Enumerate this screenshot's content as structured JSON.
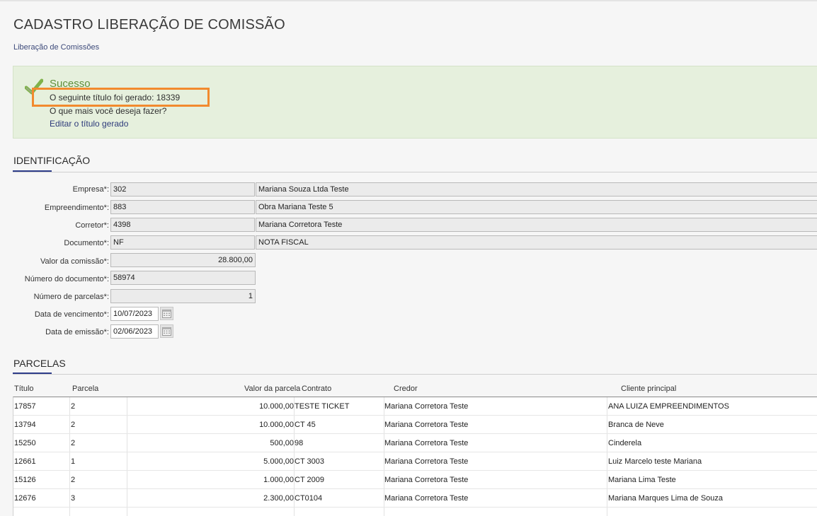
{
  "page": {
    "title": "CADASTRO LIBERAÇÃO DE COMISSÃO",
    "breadcrumb": "Liberação de Comissões"
  },
  "alert": {
    "title": "Sucesso",
    "message": "O seguinte título foi gerado: 18339",
    "question": "O que mais você deseja fazer?",
    "link": "Editar o título gerado",
    "highlight_color": "#f28a2e",
    "background_color": "#e6f0dd"
  },
  "identificacao": {
    "title": "IDENTIFICAÇÃO",
    "accent_color": "#2e3d8a",
    "fields": {
      "empresa": {
        "label": "Empresa*:",
        "code": "302",
        "desc": "Mariana Souza Ltda Teste"
      },
      "empreendimento": {
        "label": "Empreendimento*:",
        "code": "883",
        "desc": "Obra Mariana Teste 5"
      },
      "corretor": {
        "label": "Corretor*:",
        "code": "4398",
        "desc": "Mariana Corretora Teste"
      },
      "documento": {
        "label": "Documento*:",
        "code": "NF",
        "desc": "NOTA FISCAL"
      },
      "valor_comissao": {
        "label": "Valor da comissão*:",
        "value": "28.800,00"
      },
      "numero_documento": {
        "label": "Número do documento*:",
        "value": "58974"
      },
      "numero_parcelas": {
        "label": "Número de parcelas*:",
        "value": "1"
      },
      "data_vencimento": {
        "label": "Data de vencimento*:",
        "value": "10/07/2023",
        "icon": "calendar-icon"
      },
      "data_emissao": {
        "label": "Data de emissão*:",
        "value": "02/06/2023",
        "icon": "calendar-icon"
      }
    }
  },
  "parcelas": {
    "title": "PARCELAS",
    "columns": {
      "titulo": "Título",
      "parcela": "Parcela",
      "valor": "Valor da parcela",
      "contrato": "Contrato",
      "credor": "Credor",
      "cliente": "Cliente principal"
    },
    "rows": [
      {
        "titulo": "17857",
        "parcela": "2",
        "valor": "10.000,00",
        "contrato": "TESTE TICKET",
        "credor": "Mariana Corretora Teste",
        "cliente": "ANA LUIZA EMPREENDIMENTOS"
      },
      {
        "titulo": "13794",
        "parcela": "2",
        "valor": "10.000,00",
        "contrato": "CT 45",
        "credor": "Mariana Corretora Teste",
        "cliente": "Branca de Neve"
      },
      {
        "titulo": "15250",
        "parcela": "2",
        "valor": "500,00",
        "contrato": "98",
        "credor": "Mariana Corretora Teste",
        "cliente": "Cinderela"
      },
      {
        "titulo": "12661",
        "parcela": "1",
        "valor": "5.000,00",
        "contrato": "CT 3003",
        "credor": "Mariana Corretora Teste",
        "cliente": "Luiz Marcelo teste Mariana"
      },
      {
        "titulo": "15126",
        "parcela": "2",
        "valor": "1.000,00",
        "contrato": "CT 2009",
        "credor": "Mariana Corretora Teste",
        "cliente": "Mariana Lima Teste"
      },
      {
        "titulo": "12676",
        "parcela": "3",
        "valor": "2.300,00",
        "contrato": "CT0104",
        "credor": "Mariana Corretora Teste",
        "cliente": "Mariana Marques Lima de Souza"
      }
    ]
  }
}
